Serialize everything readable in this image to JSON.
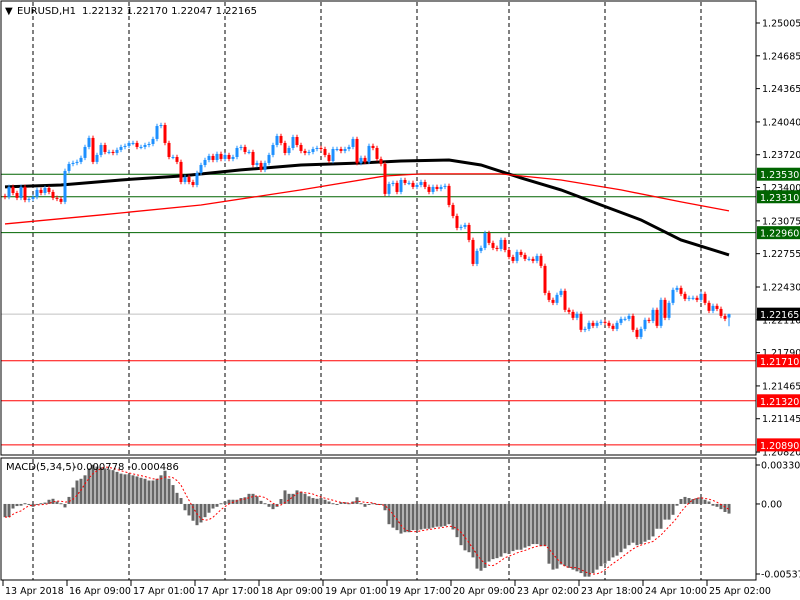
{
  "header": {
    "menu_icon": "triangle-down-icon",
    "symbol": "EURUSD,H1",
    "ohlc": "1.22132 1.22170 1.22047 1.22165"
  },
  "macd_header": {
    "label": "MACD(5,34,5)",
    "values": "-0.000778 -0.000486"
  },
  "colors": {
    "bull": "#1e90ff",
    "bear": "#ff0000",
    "ma_slow": "#000000",
    "ma_fast": "#ff0000",
    "support_level": "#006400",
    "resistance_level": "#ff0000",
    "histogram": "#666666",
    "signal": "#ff0000",
    "grid": "#000000"
  },
  "chart_data": [
    {
      "type": "candlestick",
      "title": "EURUSD,H1",
      "ylim": [
        1.2082,
        1.25005
      ],
      "y_ticks": [
        "1.25005",
        "1.24685",
        "1.24365",
        "1.24040",
        "1.23720",
        "1.23400",
        "1.23075",
        "1.22755",
        "1.22430",
        "1.22110",
        "1.21790",
        "1.21465",
        "1.21145",
        "1.20820"
      ],
      "x_tick_labels": [
        "13 Apr 2018",
        "16 Apr 09:00",
        "17 Apr 01:00",
        "17 Apr 17:00",
        "18 Apr 09:00",
        "19 Apr 01:00",
        "19 Apr 17:00",
        "20 Apr 09:00",
        "23 Apr 02:00",
        "23 Apr 18:00",
        "24 Apr 10:00",
        "25 Apr 02:00"
      ],
      "x_tick_every_bars": 16,
      "current_price": "1.22165",
      "levels": [
        {
          "price": "1.23530",
          "kind": "support"
        },
        {
          "price": "1.23310",
          "kind": "support"
        },
        {
          "price": "1.22960",
          "kind": "support"
        },
        {
          "price": "1.21710",
          "kind": "resistance"
        },
        {
          "price": "1.21320",
          "kind": "resistance"
        },
        {
          "price": "1.20890",
          "kind": "resistance"
        }
      ],
      "closes": [
        1.23308,
        1.23406,
        1.23347,
        1.23299,
        1.23406,
        1.23279,
        1.23289,
        1.23308,
        1.23377,
        1.23347,
        1.23396,
        1.23357,
        1.23299,
        1.23289,
        1.2326,
        1.23562,
        1.2363,
        1.2364,
        1.2365,
        1.23689,
        1.23796,
        1.23884,
        1.2365,
        1.23718,
        1.23815,
        1.23747,
        1.23747,
        1.23737,
        1.23767,
        1.23796,
        1.23806,
        1.23835,
        1.23835,
        1.23796,
        1.23796,
        1.23815,
        1.23825,
        1.23874,
        1.24,
        1.2401,
        1.23835,
        1.23698,
        1.23698,
        1.2365,
        1.23454,
        1.23503,
        1.23454,
        1.23425,
        1.23542,
        1.2362,
        1.23669,
        1.23708,
        1.23669,
        1.23728,
        1.23679,
        1.23718,
        1.23679,
        1.23698,
        1.23786,
        1.23796,
        1.23747,
        1.23747,
        1.2362,
        1.2364,
        1.23572,
        1.2364,
        1.23718,
        1.23815,
        1.23903,
        1.23835,
        1.23737,
        1.23786,
        1.23893,
        1.23815,
        1.23757,
        1.23737,
        1.23747,
        1.23776,
        1.23786,
        1.23776,
        1.23718,
        1.23659,
        1.23776,
        1.23776,
        1.23757,
        1.23776,
        1.23796,
        1.23874,
        1.2364,
        1.23689,
        1.2365,
        1.23806,
        1.23786,
        1.23679,
        1.2363,
        1.23338,
        1.23435,
        1.23445,
        1.23357,
        1.23474,
        1.23445,
        1.23445,
        1.23406,
        1.23425,
        1.23454,
        1.23406,
        1.23357,
        1.23406,
        1.23386,
        1.23406,
        1.23416,
        1.2323,
        1.23123,
        1.23006,
        1.23016,
        1.23035,
        1.22889,
        1.22655,
        1.22782,
        1.22811,
        1.22957,
        1.2286,
        1.22811,
        1.22801,
        1.22889,
        1.22791,
        1.22723,
        1.22684,
        1.22772,
        1.22743,
        1.22704,
        1.22704,
        1.22684,
        1.22733,
        1.22636,
        1.22372,
        1.22304,
        1.22275,
        1.22353,
        1.22392,
        1.22207,
        1.22187,
        1.22129,
        1.22168,
        1.22012,
        1.22021,
        1.2208,
        1.22051,
        1.2208,
        1.2209,
        1.2208,
        1.22051,
        1.22021,
        1.2208,
        1.22119,
        1.22119,
        1.22148,
        1.22012,
        1.21943,
        1.22021,
        1.22109,
        1.22099,
        1.22207,
        1.22051,
        1.22304,
        1.22129,
        1.22275,
        1.22402,
        1.22421,
        1.22363,
        1.22314,
        1.22324,
        1.22324,
        1.22304,
        1.22363,
        1.22275,
        1.22197,
        1.22246,
        1.22216,
        1.22148,
        1.22119,
        1.22165
      ],
      "last_bar": {
        "open": 1.22132,
        "high": 1.2217,
        "low": 1.22047,
        "close": 1.22165
      },
      "moving_averages": [
        {
          "name": "slow-ma",
          "points": [
            [
              0,
              1.23406
            ],
            [
              14,
              1.23425
            ],
            [
              29,
              1.23474
            ],
            [
              44,
              1.23513
            ],
            [
              59,
              1.23572
            ],
            [
              74,
              1.2362
            ],
            [
              89,
              1.2364
            ],
            [
              99,
              1.23659
            ],
            [
              111,
              1.23669
            ],
            [
              119,
              1.2362
            ],
            [
              129,
              1.23494
            ],
            [
              139,
              1.23377
            ],
            [
              149,
              1.2323
            ],
            [
              159,
              1.23084
            ],
            [
              169,
              1.22889
            ],
            [
              181,
              1.22743
            ]
          ]
        },
        {
          "name": "fast-ma",
          "points": [
            [
              0,
              1.23045
            ],
            [
              24,
              1.23133
            ],
            [
              49,
              1.2323
            ],
            [
              74,
              1.23377
            ],
            [
              95,
              1.23513
            ],
            [
              104,
              1.23533
            ],
            [
              124,
              1.23533
            ],
            [
              139,
              1.23474
            ],
            [
              154,
              1.23377
            ],
            [
              169,
              1.2326
            ],
            [
              181,
              1.23172
            ]
          ]
        }
      ]
    },
    {
      "type": "bar",
      "title": "MACD(5,34,5)",
      "ylim": [
        -0.006,
        0.0034
      ],
      "y_ticks": [
        "0.003306",
        "0.00",
        "-0.005378"
      ],
      "signal_period": 5,
      "histogram": [
        -0.00107,
        -0.00107,
        -0.00037,
        -0.00017,
        -0.00014,
        6e-05,
        -8e-05,
        -0.00023,
        -8e-05,
        6e-05,
        0.00011,
        0.00034,
        0.00042,
        0.0002,
        6e-05,
        -0.00028,
        0.00057,
        0.00133,
        0.0019,
        0.00204,
        0.00232,
        0.00288,
        0.00317,
        0.00303,
        0.00297,
        0.00288,
        0.0028,
        0.00274,
        0.0026,
        0.00246,
        0.0024,
        0.0024,
        0.00232,
        0.00223,
        0.00212,
        0.00204,
        0.0019,
        0.0019,
        0.00204,
        0.00232,
        0.00269,
        0.00204,
        0.00153,
        0.0009,
        0.00048,
        -0.00051,
        -0.00093,
        -0.00136,
        -0.00172,
        -0.0015,
        -0.00107,
        -0.00071,
        -0.00037,
        -0.00023,
        6e-05,
        0.0002,
        0.00034,
        0.00034,
        0.00034,
        0.00048,
        0.00054,
        0.00082,
        0.00082,
        0.00062,
        0.00025,
        6e-05,
        -0.00023,
        -0.00042,
        -0.00023,
        0.0004,
        0.0011,
        0.00082,
        0.00082,
        0.0011,
        0.00099,
        0.00082,
        0.00062,
        0.00048,
        0.00042,
        0.00048,
        0.00034,
        0.0002,
        6e-05,
        -8e-05,
        0.00014,
        0.00014,
        6e-05,
        0.0002,
        0.00054,
        6e-05,
        -0.00023,
        0.0,
        6e-05,
        -3e-05,
        -8e-05,
        -0.00051,
        -0.00164,
        -0.00192,
        -0.00212,
        -0.0024,
        -0.00229,
        -0.00229,
        -0.00212,
        -0.00212,
        -0.00207,
        -0.00201,
        -0.00201,
        -0.00192,
        -0.00184,
        -0.00184,
        -0.00178,
        -0.00164,
        -0.00207,
        -0.00269,
        -0.00334,
        -0.00376,
        -0.00391,
        -0.00433,
        -0.00524,
        -0.00541,
        -0.00518,
        -0.00467,
        -0.00447,
        -0.00439,
        -0.00427,
        -0.00399,
        -0.00405,
        -0.00382,
        -0.00371,
        -0.00371,
        -0.00354,
        -0.00342,
        -0.00325,
        -0.00325,
        -0.00342,
        -0.00342,
        -0.00484,
        -0.00532,
        -0.00524,
        -0.0049,
        -0.00504,
        -0.00518,
        -0.00532,
        -0.00546,
        -0.0056,
        -0.00589,
        -0.00589,
        -0.0056,
        -0.00532,
        -0.00504,
        -0.00484,
        -0.00461,
        -0.00433,
        -0.00419,
        -0.00391,
        -0.00362,
        -0.00334,
        -0.00314,
        -0.00334,
        -0.00325,
        -0.00306,
        -0.00291,
        -0.00263,
        -0.00201,
        -0.00201,
        -0.00127,
        -0.00127,
        -0.00088,
        -0.00014,
        0.0004,
        0.00057,
        0.00048,
        0.0004,
        0.00048,
        0.00054,
        0.00034,
        0.0002,
        -0.00014,
        -0.00023,
        -0.00042,
        -0.00065,
        -0.00078
      ]
    }
  ]
}
